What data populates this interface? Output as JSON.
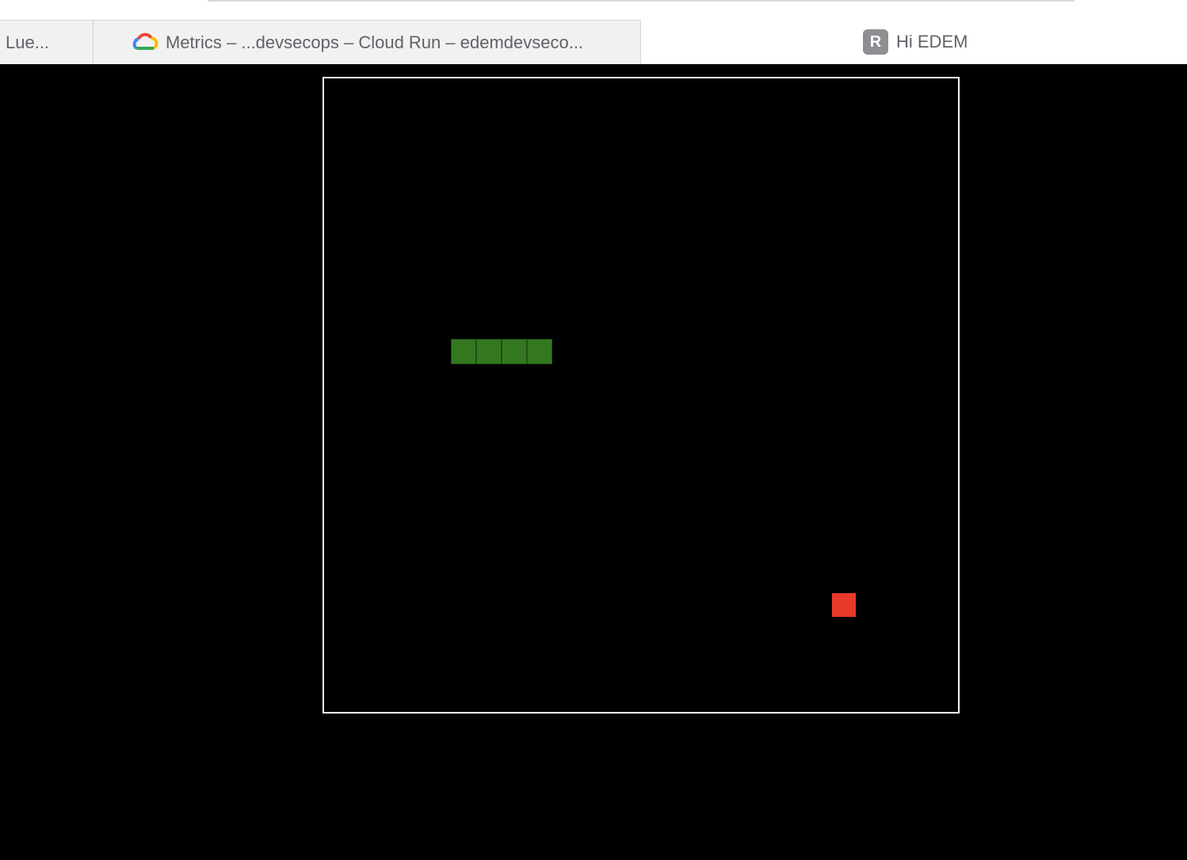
{
  "browser": {
    "tabs": [
      {
        "title": "Lue...",
        "active": false
      },
      {
        "title": "Metrics – ...devsecops – Cloud Run – edemdevseco...",
        "active": false,
        "icon": "google-cloud-icon"
      }
    ],
    "active_tab": {
      "avatar_letter": "R",
      "title": "Hi EDEM"
    }
  },
  "game": {
    "name": "snake",
    "grid": {
      "columns": 25,
      "rows": 25
    },
    "snake": {
      "color": "#33781f",
      "segments": [
        [
          5,
          10
        ],
        [
          6,
          10
        ],
        [
          7,
          10
        ],
        [
          8,
          10
        ]
      ]
    },
    "food": {
      "color": "#e8392a",
      "cell": [
        20,
        20
      ]
    },
    "board_border_color": "#ffffff",
    "background_color": "#000000"
  }
}
